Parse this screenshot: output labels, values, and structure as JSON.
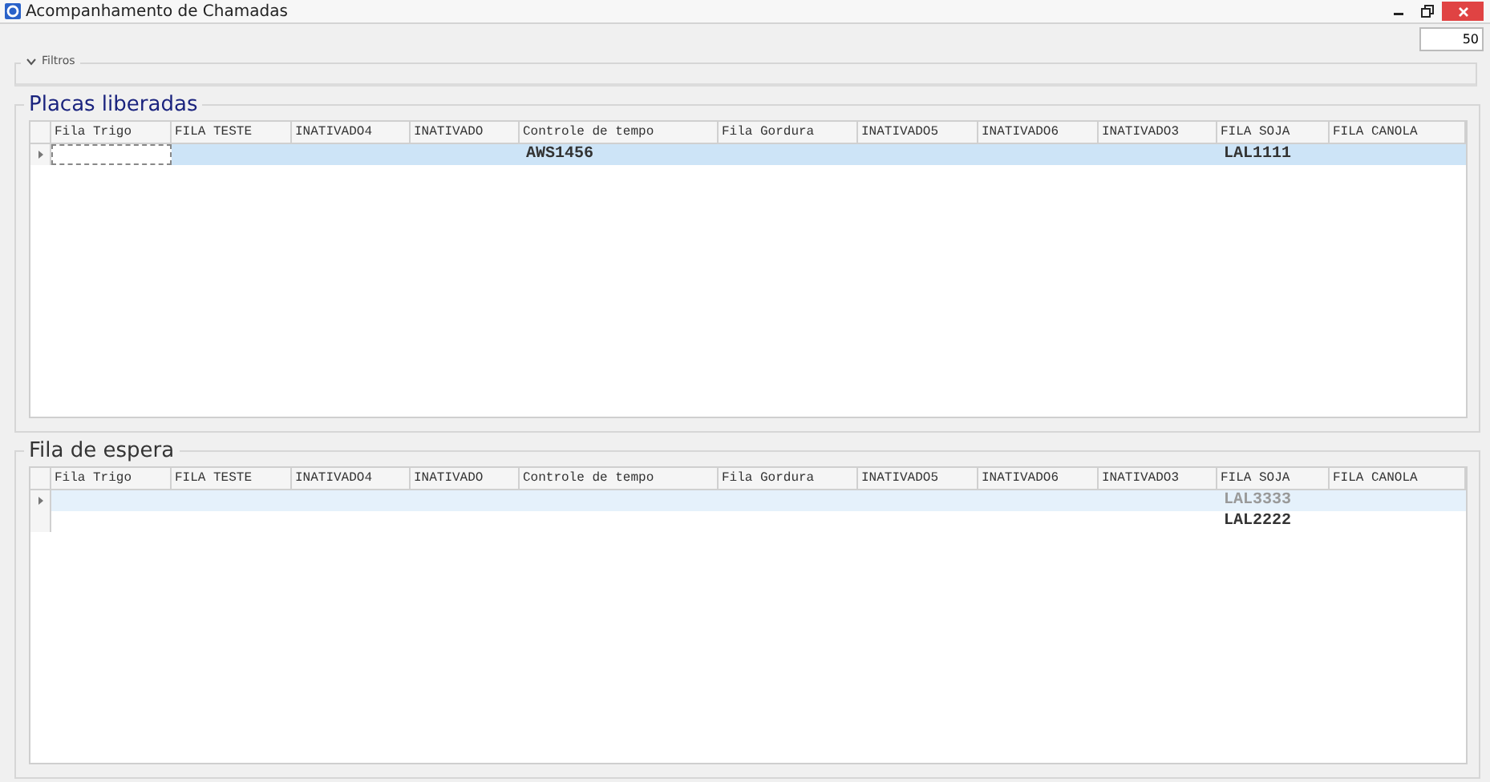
{
  "window": {
    "title": "Acompanhamento de Chamadas"
  },
  "count_field": {
    "value": "50"
  },
  "filters": {
    "label": "Filtros",
    "expanded": false
  },
  "groups": [
    {
      "title": "Placas liberadas",
      "focused": true,
      "columns": [
        "Fila Trigo",
        "FILA TESTE",
        "INATIVADO4",
        "INATIVADO",
        "Controle de tempo",
        "Fila Gordura",
        "INATIVADO5",
        "INATIVADO6",
        "INATIVADO3",
        "FILA SOJA",
        "FILA CANOLA"
      ],
      "rows": [
        {
          "selected": true,
          "cells": [
            null,
            null,
            null,
            null,
            "AWS1456",
            null,
            null,
            null,
            null,
            "LAL1111",
            null
          ]
        }
      ]
    },
    {
      "title": "Fila de espera",
      "focused": false,
      "columns": [
        "Fila Trigo",
        "FILA TESTE",
        "INATIVADO4",
        "INATIVADO",
        "Controle de tempo",
        "Fila Gordura",
        "INATIVADO5",
        "INATIVADO6",
        "INATIVADO3",
        "FILA SOJA",
        "FILA CANOLA"
      ],
      "rows": [
        {
          "selected": true,
          "cells": [
            null,
            null,
            null,
            null,
            null,
            null,
            null,
            null,
            null,
            "LAL3333",
            null
          ]
        },
        {
          "selected": false,
          "cells": [
            null,
            null,
            null,
            null,
            null,
            null,
            null,
            null,
            null,
            "LAL2222",
            null
          ]
        }
      ]
    }
  ]
}
